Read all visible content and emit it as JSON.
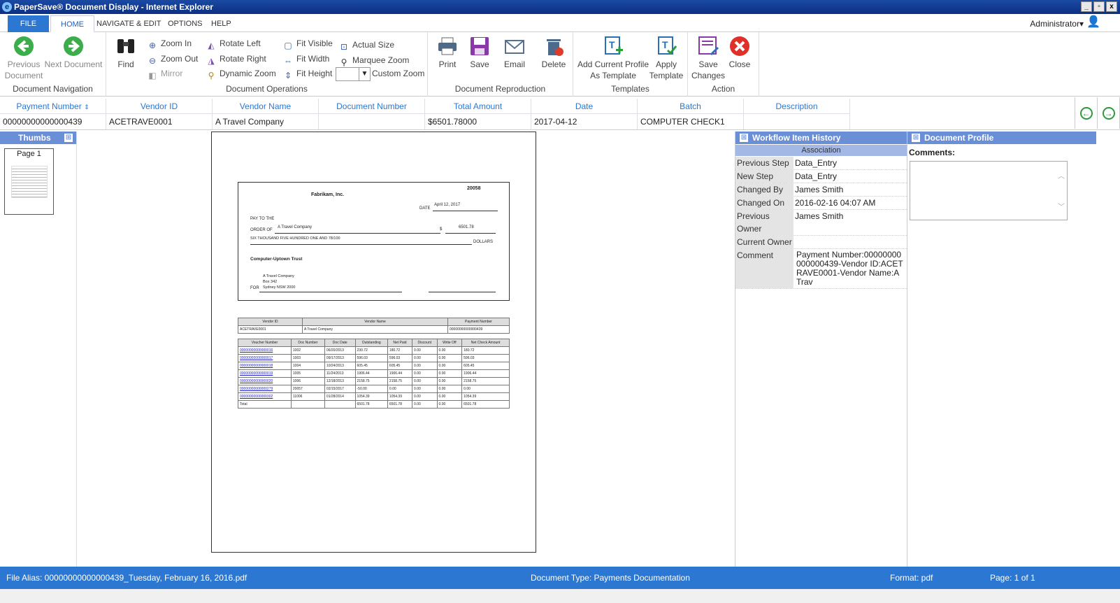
{
  "window": {
    "title": "PaperSave® Document Display - Internet Explorer",
    "buttons": [
      "_",
      "▫",
      "x"
    ]
  },
  "menu": {
    "tabs": [
      "FILE",
      "HOME",
      "NAVIGATE & EDIT",
      "OPTIONS",
      "HELP"
    ],
    "user": "Administrator"
  },
  "ribbon": {
    "nav": {
      "prev1": "Previous",
      "prev2": "Document",
      "next": "Next Document",
      "label": "Document Navigation"
    },
    "ops": {
      "find": "Find",
      "zoom_in": "Zoom In",
      "zoom_out": "Zoom Out",
      "mirror": "Mirror",
      "rotate_left": "Rotate Left",
      "rotate_right": "Rotate Right",
      "dynamic_zoom": "Dynamic Zoom",
      "fit_visible": "Fit Visible",
      "fit_width": "Fit Width",
      "fit_height": "Fit Height",
      "actual_size": "Actual Size",
      "marquee_zoom": "Marquee Zoom",
      "custom_zoom": "Custom Zoom",
      "label": "Document Operations"
    },
    "repro": {
      "print": "Print",
      "save": "Save",
      "email": "Email",
      "delete": "Delete",
      "label": "Document Reproduction"
    },
    "templates": {
      "add1": "Add Current Profile",
      "add2": "As Template",
      "apply1": "Apply",
      "apply2": "Template",
      "label": "Templates"
    },
    "action": {
      "save1": "Save",
      "save2": "Changes",
      "close": "Close",
      "label": "Action"
    }
  },
  "grid": {
    "headers": [
      "Payment Number",
      "Vendor ID",
      "Vendor Name",
      "Document Number",
      "Total Amount",
      "Date",
      "Batch",
      "Description"
    ],
    "row": [
      "00000000000000439",
      "ACETRAVE0001",
      "A Travel Company",
      "",
      "$6501.78000",
      "2017-04-12",
      "COMPUTER CHECK1",
      ""
    ]
  },
  "thumbs": {
    "title": "Thumbs",
    "page": "Page 1"
  },
  "check": {
    "company": "Fabrikam, Inc.",
    "number": "20058",
    "date_label": "DATE",
    "date": "April 12, 2017",
    "pay": "PAY TO THE",
    "order": "ORDER OF",
    "payee": "A Travel Company",
    "dollar": "$",
    "amount": "6501.78",
    "words": "SIX THOUSAND FIVE HUNDRED ONE AND 78/100",
    "dollars": "DOLLARS",
    "bank": "Computer-Uptown Trust",
    "addr1": "A Travel Company",
    "addr2": "Box 342",
    "addr3": "Sydney NSW 2000",
    "for": "FOR"
  },
  "stub": {
    "h1": [
      "Vendor ID",
      "Vendor Name",
      "Payment Number"
    ],
    "r1": [
      "ACETRAVE0001",
      "A Travel Company",
      "00000000000000439"
    ],
    "h2": [
      "Voucher Number",
      "Doc Number",
      "Doc Date",
      "Outstanding",
      "Net Paid",
      "Discount",
      "Write Off",
      "Net Check Amount"
    ],
    "rows": [
      [
        "00000000000000016",
        "1002",
        "06/20/2013",
        "230.72",
        "180.72",
        "0.00",
        "0.00",
        "180.72"
      ],
      [
        "00000000000000017",
        "1003",
        "09/17/2013",
        "596.03",
        "596.03",
        "0.00",
        "0.00",
        "596.03"
      ],
      [
        "00000000000000018",
        "1004",
        "10/24/2013",
        "605.45",
        "605.45",
        "0.00",
        "0.00",
        "605.45"
      ],
      [
        "00000000000000019",
        "1005",
        "11/24/2013",
        "1906.44",
        "1906.44",
        "0.00",
        "0.00",
        "1906.44"
      ],
      [
        "00000000000000020",
        "1006",
        "12/18/2013",
        "2158.75",
        "2158.75",
        "0.00",
        "0.00",
        "2158.75"
      ],
      [
        "00000000000000279",
        "20057",
        "02/15/2017",
        "-50.00",
        "0.00",
        "0.00",
        "0.00",
        "0.00"
      ],
      [
        "00000000000000302",
        "11006",
        "01/28/2014",
        "1054.39",
        "1054.39",
        "0.00",
        "0.00",
        "1054.39"
      ],
      [
        "Total",
        "",
        "",
        "6501.78",
        "6501.78",
        "0.00",
        "0.00",
        "6501.78"
      ]
    ]
  },
  "workflow": {
    "title": "Workflow Item History",
    "assoc": "Association",
    "rows": [
      [
        "Previous Step",
        "Data_Entry"
      ],
      [
        "New Step",
        "Data_Entry"
      ],
      [
        "Changed By",
        "James Smith"
      ],
      [
        "Changed On",
        "2016-02-16 04:07 AM"
      ],
      [
        "Previous Owner",
        "James Smith"
      ],
      [
        "Current Owner",
        ""
      ]
    ],
    "comment_label": "Comment",
    "comment": "Payment Number:00000000000000439-Vendor ID:ACETRAVE0001-Vendor Name:A Trav"
  },
  "profile": {
    "title": "Document Profile",
    "comments": "Comments:"
  },
  "status": {
    "alias": "File Alias: 00000000000000439_Tuesday, February 16, 2016.pdf",
    "type": "Document Type: Payments Documentation",
    "format": "Format: pdf",
    "page": "Page: 1 of 1"
  }
}
